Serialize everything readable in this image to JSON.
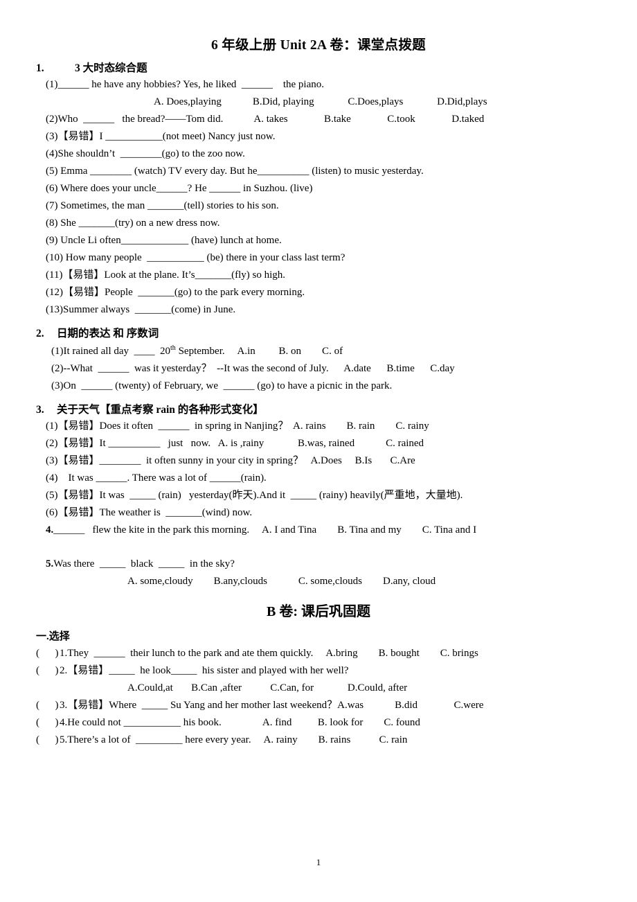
{
  "document": {
    "title": "6 年级上册    Unit 2A 卷：课堂点拨题",
    "page_number": "1",
    "section_b_title": "B 卷: 课后巩固题"
  },
  "section1": {
    "heading_num": "1.",
    "heading_text": "3 大时态综合题",
    "items": [
      "(1)______ he have any hobbies? Yes, he liked  ______    the piano.",
      "(2)Who  ______   the bread?——Tom did.",
      "(3)【易错】I ___________(not meet) Nancy just now.",
      "(4)She shouldn’t  ________(go) to the zoo now.",
      "(5) Emma ________ (watch) TV every day. But he__________ (listen) to music yesterday.",
      "(6) Where does your uncle______? He ______ in Suzhou. (live)",
      "(7) Sometimes, the man _______(tell) stories to his son.",
      "(8) She _______(try) on a new dress now.",
      "(9) Uncle Li often_____________ (have) lunch at home.",
      "(10) How many people  ___________ (be) there in your class last term?",
      "(11)【易错】Look at the plane. It’s_______(fly) so high.",
      "(12)【易错】People  _______(go) to the park every morning.",
      "(13)Summer always  _______(come) in June."
    ],
    "q1_options": "A. Does,playing            B.Did, playing             C.Does,plays             D.Did,plays",
    "q2_options": "A. takes              B.take              C.took              D.taked"
  },
  "section2": {
    "heading_num": "2.",
    "heading_text": "日期的表达    和    序数词",
    "items": [
      "(1)It rained all day  ____  20th September.     A.in         B. on        C. of",
      "(2)--What  ______  was it yesterday？  --It was the second of July.      A.date      B.time      C.day",
      "(3)On  ______ (twenty) of February, we  ______ (go) to have a picnic in the park."
    ],
    "q1_prefix": "(1)It rained all day  ____  20",
    "q1_sup": "th",
    "q1_suffix": " September.     A.in         B. on        C. of"
  },
  "section3": {
    "heading_num": "3.",
    "heading_text": "关于天气【重点考察 rain 的各种形式变化】",
    "items": [
      "(1)【易错】Does it often  ______  in spring in Nanjing？  A. rains        B. rain        C. rainy",
      "(2)【易错】It __________   just   now.   A. is ,rainy             B.was, rained            C. rained",
      "(3)【易错】________  it often sunny in your city in spring？   A.Does     B.Is       C.Are",
      "(4)    It was ______. There was a lot of ______(rain).",
      "(5)【易错】It was  _____ (rain)   yesterday(昨天).And it  _____ (rainy) heavily(严重地，大量地).",
      "(6)【易错】The weather is  _______(wind) now."
    ]
  },
  "section4": {
    "heading_num": "4.",
    "text": "______   flew the kite in the park this morning.     A. I and Tina        B. Tina and my        C. Tina and I"
  },
  "section5": {
    "heading_num": "5.",
    "text": "Was there  _____  black  _____  in the sky?",
    "options": "A. some,cloudy        B.any,clouds            C. some,clouds        D.any, cloud"
  },
  "section_b": {
    "part1_heading": "一.选择",
    "items": [
      {
        "mark": "(      )",
        "text": "1.They  ______  their lunch to the park and ate them quickly.     A.bring        B. bought        C. brings"
      },
      {
        "mark": "(      )",
        "text": "2.【易错】_____  he look_____  his sister and played with her well?"
      },
      {
        "mark": "(      )",
        "text": "3.【易错】Where  _____ Su Yang and her mother last weekend？A.was            B.did              C.were"
      },
      {
        "mark": "(      )",
        "text": "4.He could not ___________ his book.                A. find          B. look for        C. found"
      },
      {
        "mark": "(      )",
        "text": "5.There’s a lot of  _________ here every year.     A. rainy        B. rains           C. rain"
      }
    ],
    "q2_options": "A.Could,at       B.Can ,after           C.Can, for             D.Could, after"
  }
}
